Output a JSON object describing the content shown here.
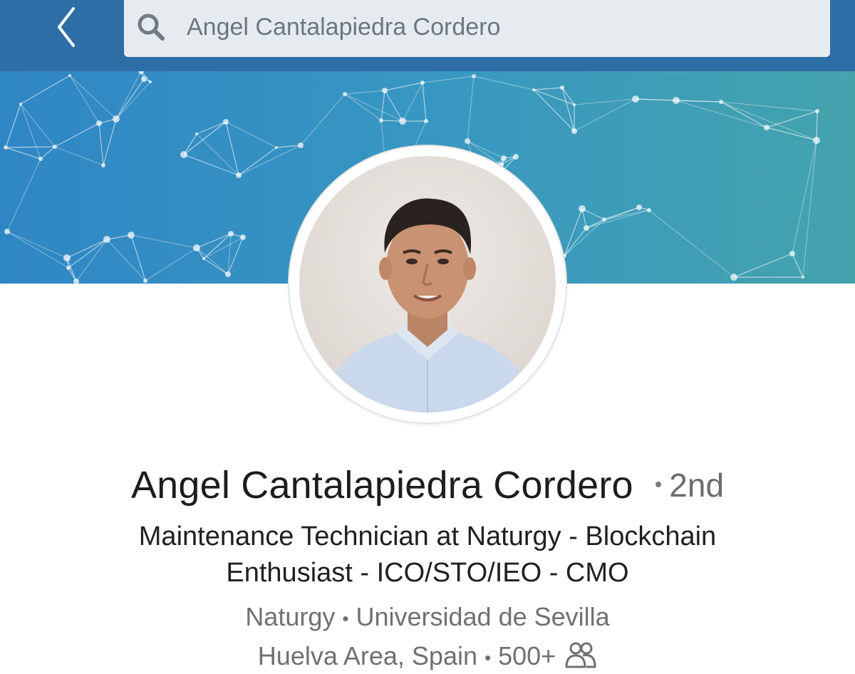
{
  "nav": {
    "back_icon": "chevron-left-icon",
    "search_icon": "search-icon",
    "search_value": "Angel Cantalapiedra Cordero"
  },
  "colors": {
    "nav_bar": "#2e6ea6",
    "search_box": "#e6ebf0",
    "cover_start": "#2f86c4",
    "cover_end": "#44a3ad"
  },
  "profile": {
    "name": "Angel Cantalapiedra Cordero",
    "degree_separator": "•",
    "degree": "2nd",
    "headline_line1": "Maintenance Technician at Naturgy - Blockchain",
    "headline_line2": "Enthusiast - ICO/STO/IEO - CMO",
    "company": "Naturgy",
    "education": "Universidad de Sevilla",
    "location": "Huelva Area, Spain",
    "connections": "500+",
    "separator": "•",
    "connections_icon": "people-icon"
  }
}
